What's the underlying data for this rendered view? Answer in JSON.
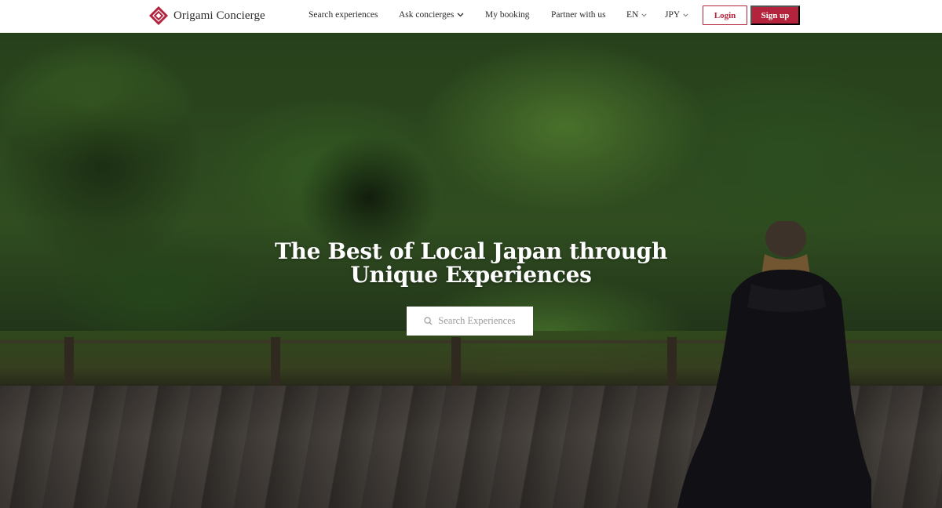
{
  "brand": {
    "name": "Origami Concierge",
    "accent": "#b3233b"
  },
  "nav": {
    "items": [
      {
        "label": "Search experiences"
      },
      {
        "label": "Ask concierges",
        "icon": "chevron-down-icon"
      },
      {
        "label": "My booking"
      },
      {
        "label": "Partner with us"
      },
      {
        "label": "EN",
        "icon": "chevron-down-icon"
      },
      {
        "label": "JPY",
        "icon": "chevron-down-icon"
      }
    ],
    "login_label": "Login",
    "signup_label": "Sign up"
  },
  "hero": {
    "title_line1": "The Best of Local Japan through",
    "title_line2": "Unique Experiences",
    "search_label": "Search Experiences",
    "search_icon": "search-icon"
  }
}
